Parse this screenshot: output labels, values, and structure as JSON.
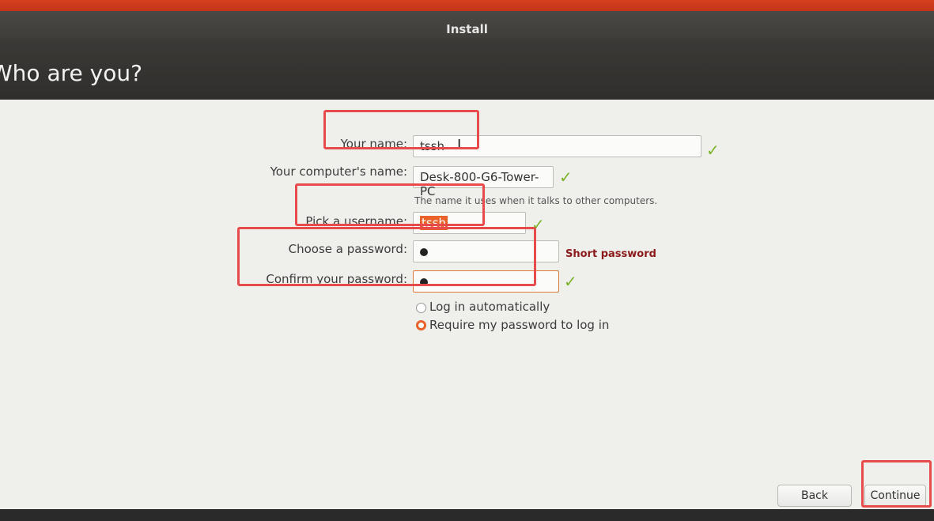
{
  "window": {
    "title": "Install",
    "heading": "Who are you?"
  },
  "form": {
    "name": {
      "label": "Your name:",
      "value": "tssh"
    },
    "computer": {
      "label": "Your computer's name:",
      "value": "Desk-800-G6-Tower-PC",
      "hint": "The name it uses when it talks to other computers."
    },
    "username": {
      "label": "Pick a username:",
      "value": "tssh"
    },
    "password": {
      "label": "Choose a password:",
      "strength": "Short password"
    },
    "confirm": {
      "label": "Confirm your password:"
    },
    "login_options": [
      {
        "label": "Log in automatically",
        "selected": false
      },
      {
        "label": "Require my password to log in",
        "selected": true
      }
    ]
  },
  "buttons": {
    "back": "Back",
    "continue": "Continue"
  },
  "colors": {
    "accent": "#e8622a",
    "valid": "#7cb22a",
    "warning": "#8b1a1a",
    "annotation": "#e84b4b"
  }
}
